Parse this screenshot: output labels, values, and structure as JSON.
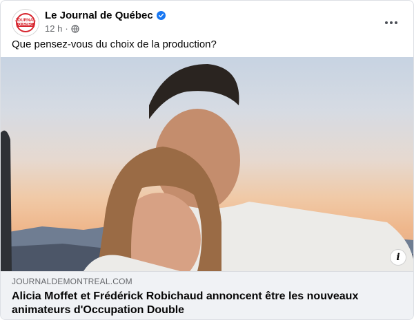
{
  "post": {
    "page_name": "Le Journal de Québec",
    "time": "12 h",
    "separator": "·",
    "text": "Que pensez-vous du choix de la production?",
    "avatar_logo_top": "JOURNAL",
    "avatar_logo_bottom": "QUÉBEC"
  },
  "icons": {
    "verified": "verified-badge-icon",
    "audience": "globe-icon",
    "more": "more-options-icon",
    "info": "info-icon"
  },
  "link_preview": {
    "domain": "JOURNALDEMONTREAL.COM",
    "title": "Alicia Moffet et Frédérick Robichaud annoncent être les nouveaux animateurs d'Occupation Double"
  },
  "info_glyph": "i",
  "colors": {
    "brand_blue": "#1877f2",
    "logo_red": "#d7262f",
    "secondary_text": "#65676b",
    "link_bg": "#f0f2f5"
  }
}
